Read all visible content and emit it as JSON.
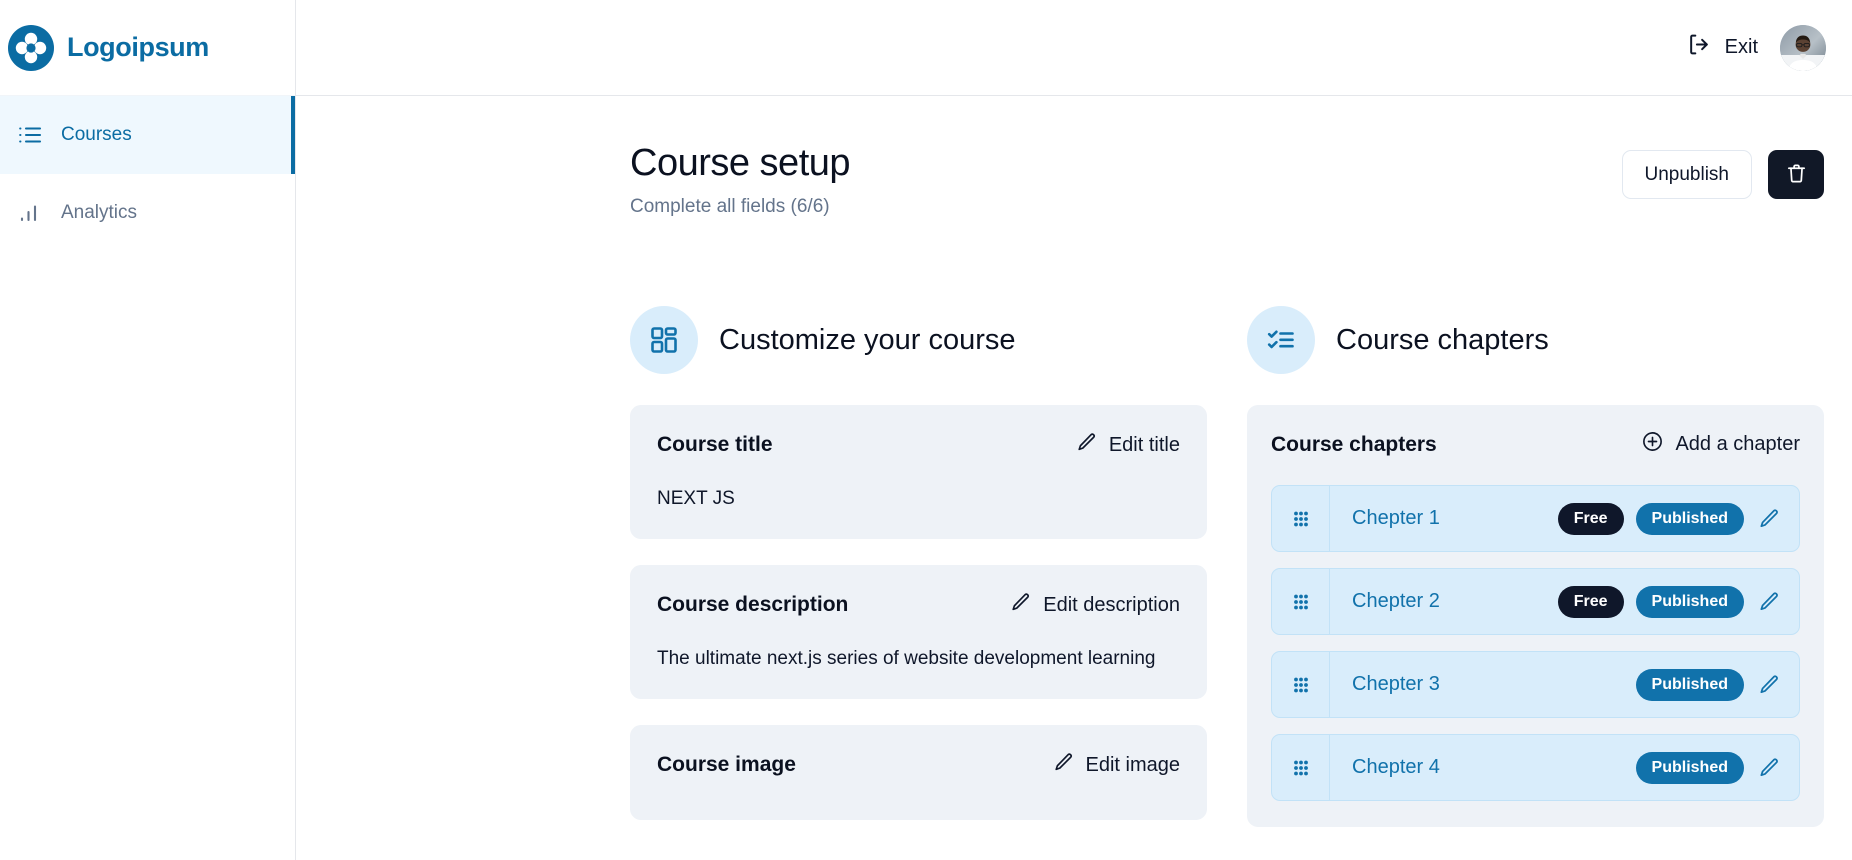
{
  "brand": {
    "name": "Logoipsum",
    "logo_icon": "clover-logo-icon"
  },
  "sidebar": {
    "items": [
      {
        "label": "Courses",
        "icon": "list-icon",
        "active": true
      },
      {
        "label": "Analytics",
        "icon": "bar-chart-icon",
        "active": false
      }
    ]
  },
  "topbar": {
    "exit_label": "Exit",
    "exit_icon": "logout-icon",
    "avatar_icon": "user-avatar"
  },
  "page": {
    "title": "Course setup",
    "subtitle": "Complete all fields (6/6)",
    "unpublish_label": "Unpublish",
    "delete_icon": "trash-icon"
  },
  "customize": {
    "section_title": "Customize your course",
    "section_icon": "layout-dashboard-icon",
    "cards": [
      {
        "label": "Course title",
        "action": "Edit title",
        "action_icon": "pencil-icon",
        "value": "NEXT JS"
      },
      {
        "label": "Course description",
        "action": "Edit description",
        "action_icon": "pencil-icon",
        "value": "The ultimate next.js series of website development learning"
      },
      {
        "label": "Course image",
        "action": "Edit image",
        "action_icon": "pencil-icon",
        "value": ""
      }
    ]
  },
  "chapters": {
    "section_title": "Course chapters",
    "section_icon": "checklist-icon",
    "card_label": "Course chapters",
    "add_label": "Add a chapter",
    "add_icon": "plus-circle-icon",
    "rows": [
      {
        "title": "Chepter 1",
        "free": "Free",
        "published": "Published",
        "grip_icon": "grip-icon",
        "edit_icon": "pencil-icon"
      },
      {
        "title": "Chepter 2",
        "free": "Free",
        "published": "Published",
        "grip_icon": "grip-icon",
        "edit_icon": "pencil-icon"
      },
      {
        "title": "Chepter 3",
        "free": "",
        "published": "Published",
        "grip_icon": "grip-icon",
        "edit_icon": "pencil-icon"
      },
      {
        "title": "Chepter 4",
        "free": "",
        "published": "Published",
        "grip_icon": "grip-icon",
        "edit_icon": "pencil-icon"
      }
    ]
  },
  "colors": {
    "brand_blue": "#0b6ca3",
    "accent_blue": "#1172ab",
    "chip_dark": "#0f172a",
    "row_bg": "#d9edfb",
    "card_bg": "#eef2f7"
  }
}
